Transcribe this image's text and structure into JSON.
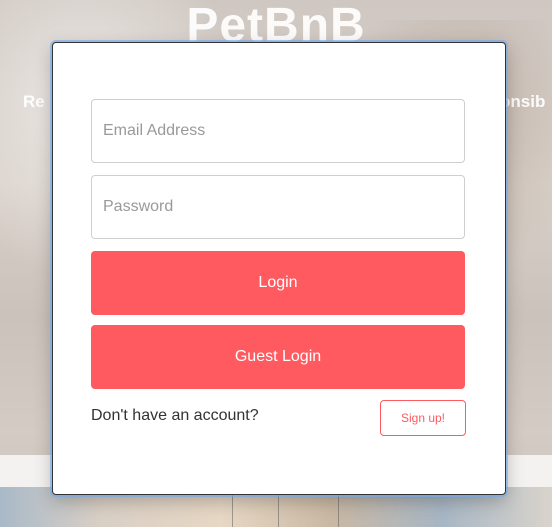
{
  "background": {
    "brand_title": "PetBnB",
    "tagline_left": "Re",
    "tagline_right": "onsib"
  },
  "login_modal": {
    "email": {
      "placeholder": "Email Address",
      "value": ""
    },
    "password": {
      "placeholder": "Password",
      "value": ""
    },
    "login_label": "Login",
    "guest_login_label": "Guest Login",
    "no_account_text": "Don't have an account?",
    "signup_label": "Sign up!"
  },
  "colors": {
    "brand_accent": "#ff5a5f",
    "modal_border": "#333333",
    "text": "#333333",
    "placeholder": "#999999"
  }
}
